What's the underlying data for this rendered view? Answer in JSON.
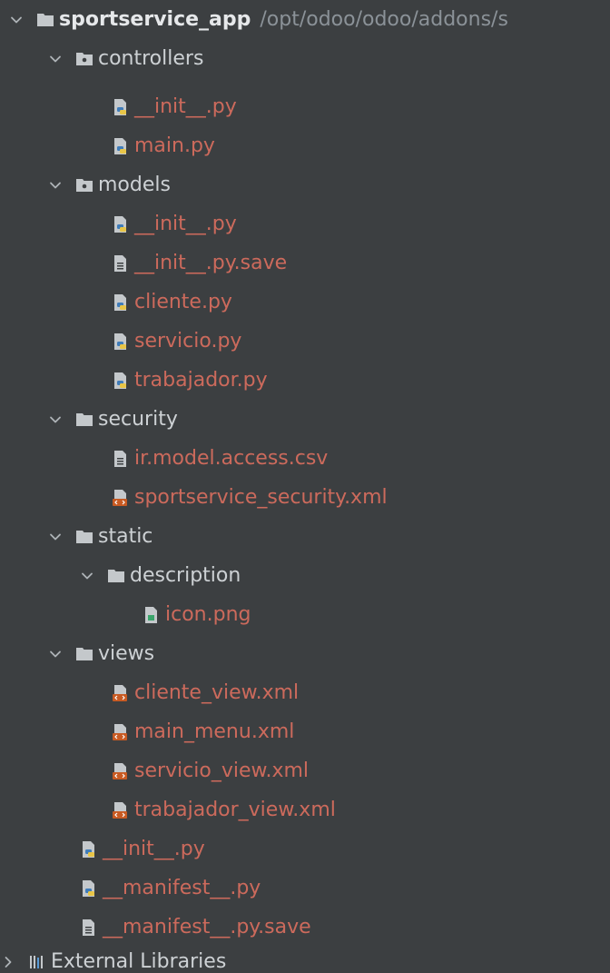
{
  "colors": {
    "background": "#3c3f41",
    "folder_text": "#cdd1d4",
    "file_text_modified": "#cc6a5c",
    "path_text": "#8b9298"
  },
  "tree": {
    "root": {
      "label": "sportservice_app",
      "path": "/opt/odoo/odoo/addons/s",
      "icon": "folder-icon",
      "expanded": true
    },
    "controllers": {
      "label": "controllers",
      "icon": "package-folder-icon",
      "expanded": true
    },
    "controllers_init": {
      "label": "__init__.py",
      "icon": "python-file-icon"
    },
    "controllers_main": {
      "label": "main.py",
      "icon": "python-file-icon"
    },
    "models": {
      "label": "models",
      "icon": "package-folder-icon",
      "expanded": true
    },
    "models_init": {
      "label": "__init__.py",
      "icon": "python-file-icon"
    },
    "models_init_save": {
      "label": "__init__.py.save",
      "icon": "text-file-icon"
    },
    "models_cliente": {
      "label": "cliente.py",
      "icon": "python-file-icon"
    },
    "models_servicio": {
      "label": "servicio.py",
      "icon": "python-file-icon"
    },
    "models_trabajador": {
      "label": "trabajador.py",
      "icon": "python-file-icon"
    },
    "security": {
      "label": "security",
      "icon": "folder-icon",
      "expanded": true
    },
    "security_access": {
      "label": "ir.model.access.csv",
      "icon": "text-file-icon"
    },
    "security_xml": {
      "label": "sportservice_security.xml",
      "icon": "xml-file-icon"
    },
    "static": {
      "label": "static",
      "icon": "folder-icon",
      "expanded": true
    },
    "description": {
      "label": "description",
      "icon": "folder-icon",
      "expanded": true
    },
    "icon_png": {
      "label": "icon.png",
      "icon": "image-file-icon"
    },
    "views": {
      "label": "views",
      "icon": "folder-icon",
      "expanded": true
    },
    "views_cliente": {
      "label": "cliente_view.xml",
      "icon": "xml-file-icon"
    },
    "views_main_menu": {
      "label": "main_menu.xml",
      "icon": "xml-file-icon"
    },
    "views_servicio": {
      "label": "servicio_view.xml",
      "icon": "xml-file-icon"
    },
    "views_trabajador": {
      "label": "trabajador_view.xml",
      "icon": "xml-file-icon"
    },
    "root_init": {
      "label": "__init__.py",
      "icon": "python-file-icon"
    },
    "root_manifest": {
      "label": "__manifest__.py",
      "icon": "python-file-icon"
    },
    "root_manifest_save": {
      "label": "__manifest__.py.save",
      "icon": "text-file-icon"
    },
    "external_libraries": {
      "label": "External Libraries",
      "icon": "library-icon",
      "expanded": false
    }
  }
}
